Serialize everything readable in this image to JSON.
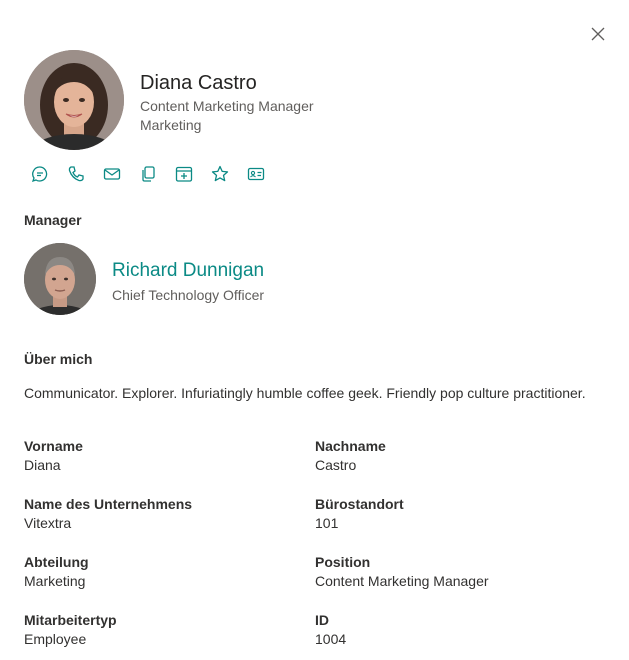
{
  "profile": {
    "name": "Diana Castro",
    "title": "Content Marketing Manager",
    "department": "Marketing"
  },
  "actions": [
    {
      "icon": "chat-icon"
    },
    {
      "icon": "phone-icon"
    },
    {
      "icon": "mail-icon"
    },
    {
      "icon": "copy-icon"
    },
    {
      "icon": "calendar-add-icon"
    },
    {
      "icon": "star-icon"
    },
    {
      "icon": "contact-card-icon"
    }
  ],
  "manager_section": {
    "heading": "Manager",
    "name": "Richard Dunnigan",
    "title": "Chief Technology Officer"
  },
  "about_section": {
    "heading": "Über mich",
    "text": "Communicator. Explorer. Infuriatingly humble coffee geek. Friendly pop culture practitioner."
  },
  "fields": [
    {
      "label": "Vorname",
      "value": "Diana"
    },
    {
      "label": "Nachname",
      "value": "Castro"
    },
    {
      "label": "Name des Unternehmens",
      "value": "Vitextra"
    },
    {
      "label": "Bürostandort",
      "value": "101"
    },
    {
      "label": "Abteilung",
      "value": "Marketing"
    },
    {
      "label": "Position",
      "value": "Content Marketing Manager"
    },
    {
      "label": "Mitarbeitertyp",
      "value": "Employee"
    },
    {
      "label": "ID",
      "value": "1004"
    }
  ],
  "colors": {
    "accent": "#0b8a85",
    "text": "#323130",
    "secondary_text": "#605e5c"
  }
}
